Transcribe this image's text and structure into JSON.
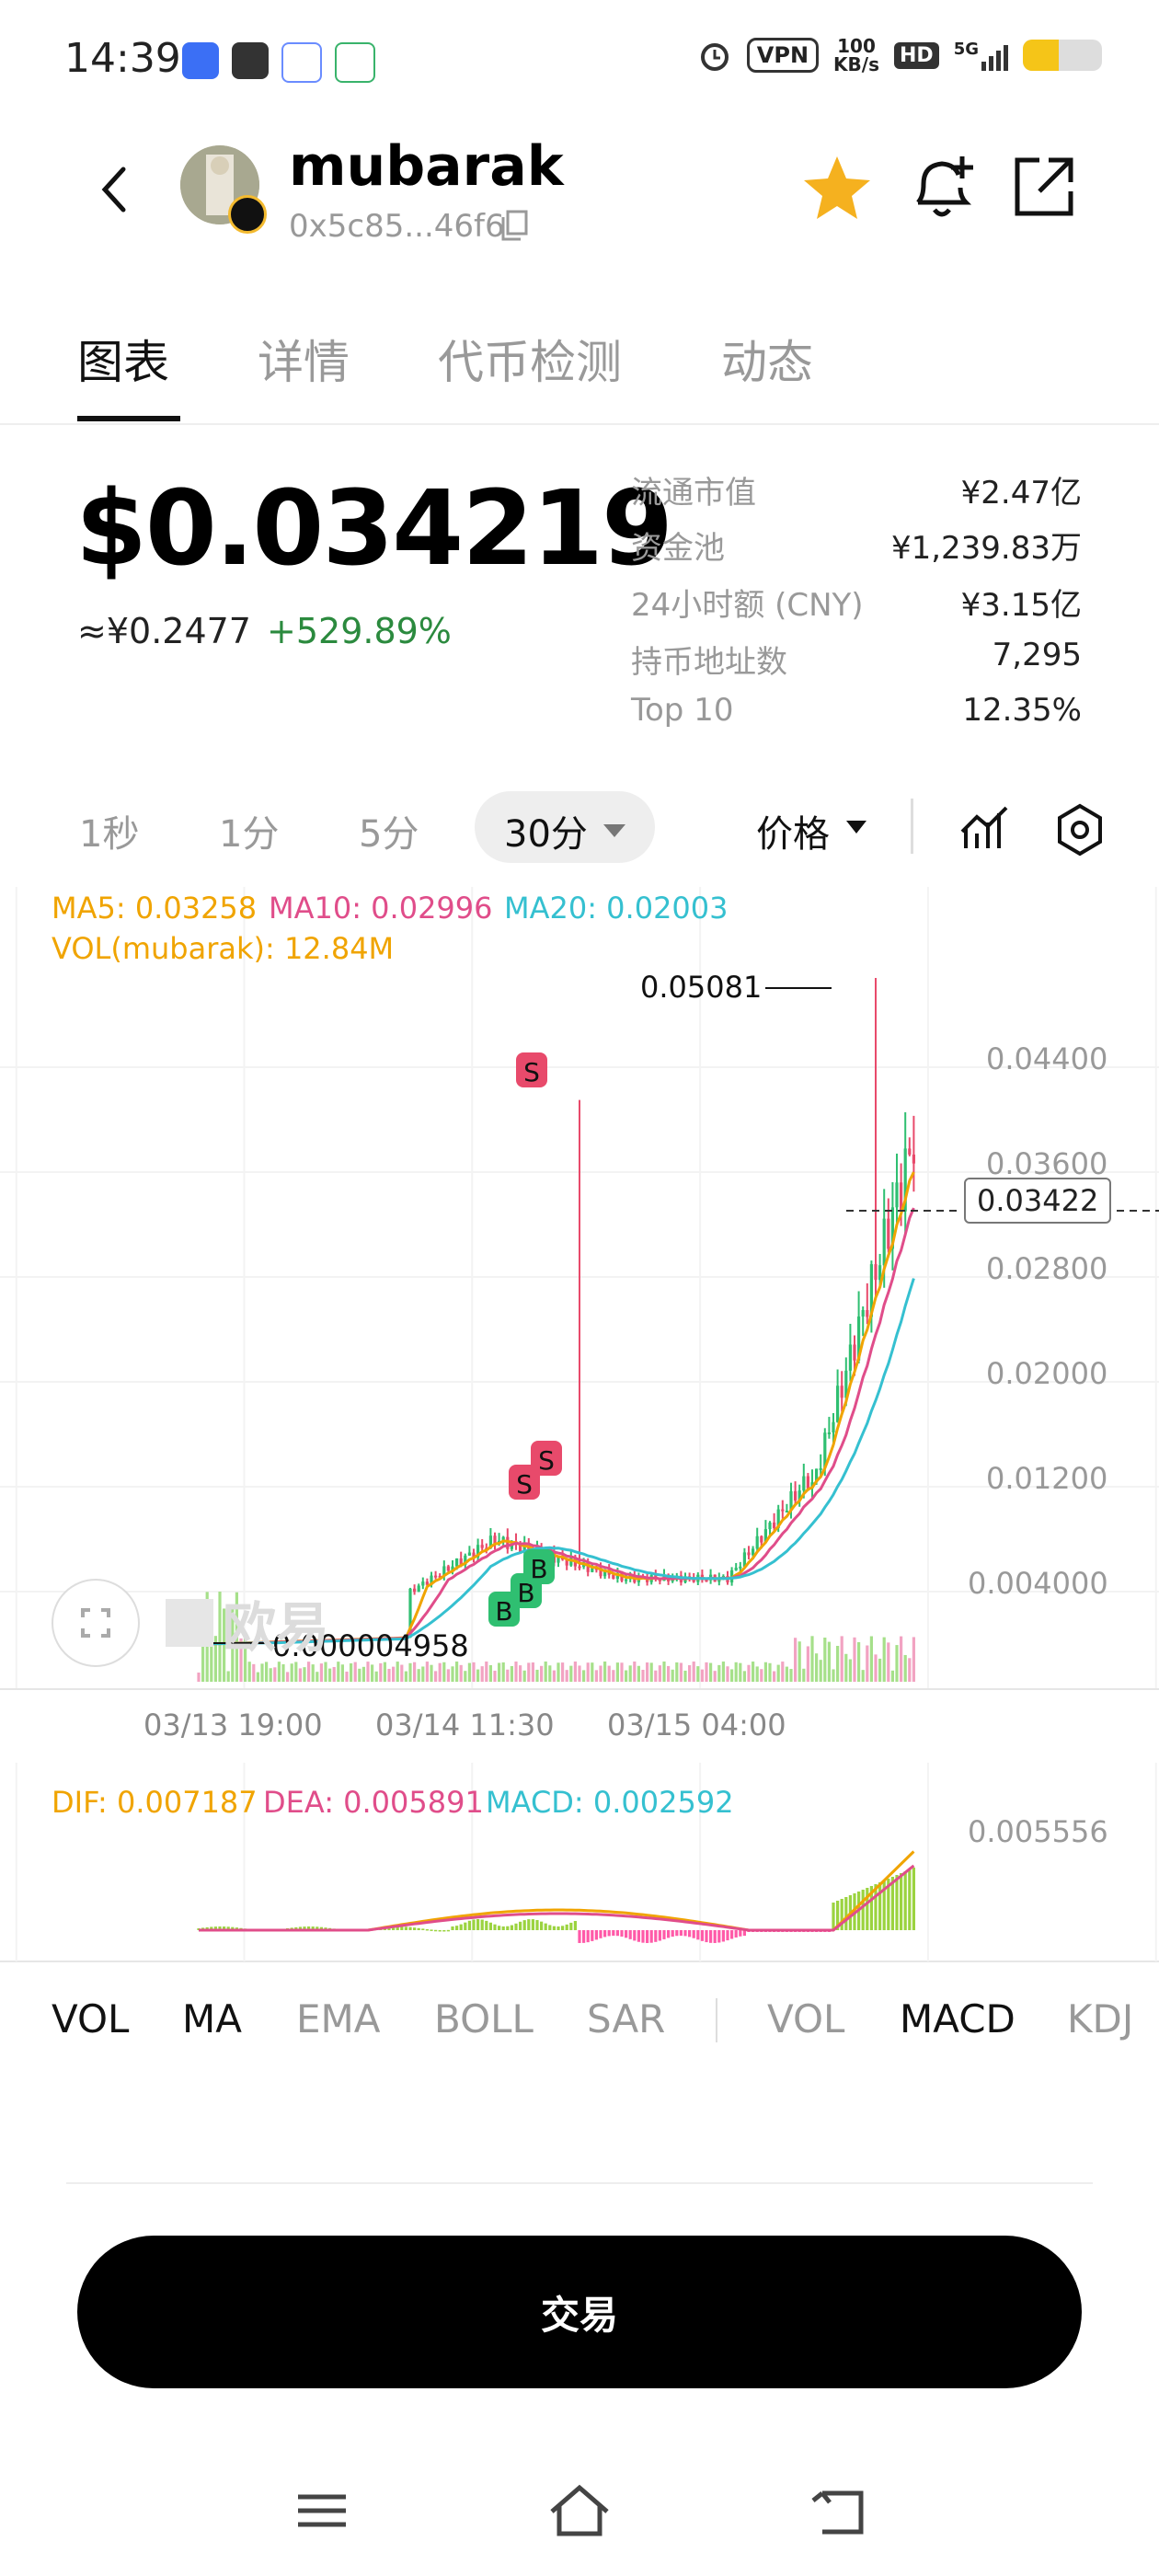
{
  "status_bar": {
    "time": "14:39",
    "vpn": "VPN",
    "speed_value": "100",
    "speed_unit": "KB/s",
    "hd": "HD",
    "network": "5G",
    "battery_level": 0.45
  },
  "header": {
    "token_name": "mubarak",
    "address": "0x5c85...46f6"
  },
  "tabs": [
    {
      "label": "图表"
    },
    {
      "label": "详情"
    },
    {
      "label": "代币检测"
    },
    {
      "label": "动态"
    }
  ],
  "price": {
    "usd": "$0.034219",
    "cny": "≈¥0.2477",
    "change": "+529.89%"
  },
  "stats": [
    {
      "label": "流通市值",
      "value": "¥2.47亿"
    },
    {
      "label": "资金池",
      "value": "¥1,239.83万"
    },
    {
      "label": "24小时额 (CNY)",
      "value": "¥3.15亿"
    },
    {
      "label": "持币地址数",
      "value": "7,295"
    },
    {
      "label": "Top 10",
      "value": "12.35%"
    }
  ],
  "intervals": {
    "options": [
      "1秒",
      "1分",
      "5分"
    ],
    "selected": "30分",
    "price_mode": "价格"
  },
  "chart_data": {
    "type": "candlestick",
    "legend": {
      "ma5": "MA5: 0.03258",
      "ma10": "MA10: 0.02996",
      "ma20": "MA20: 0.02003",
      "vol": "VOL(mubarak): 12.84M"
    },
    "y_ticks": [
      "0.04400",
      "0.03600",
      "0.02800",
      "0.02000",
      "0.01200",
      "0.004000"
    ],
    "x_ticks": [
      "03/13 19:00",
      "03/14 11:30",
      "03/15 04:00"
    ],
    "current_price_label": "0.03422",
    "high_label": "0.05081",
    "low_label": "0.000004958",
    "markers": [
      "S",
      "S",
      "S",
      "B",
      "B",
      "B"
    ],
    "watermark": "欧易",
    "colors": {
      "up": "#2fbf71",
      "down": "#e84a6b",
      "ma5": "#f0a400",
      "ma10": "#e04d8a",
      "ma20": "#35c0d0"
    },
    "macd": {
      "dif": "DIF: 0.007187",
      "dea": "DEA: 0.005891",
      "macd": "MACD: 0.002592",
      "y_tick": "0.005556"
    }
  },
  "indicators": {
    "main": [
      "VOL",
      "MA",
      "EMA",
      "BOLL",
      "SAR"
    ],
    "sub": [
      "VOL",
      "MACD",
      "KDJ"
    ]
  },
  "trade_button": "交易"
}
